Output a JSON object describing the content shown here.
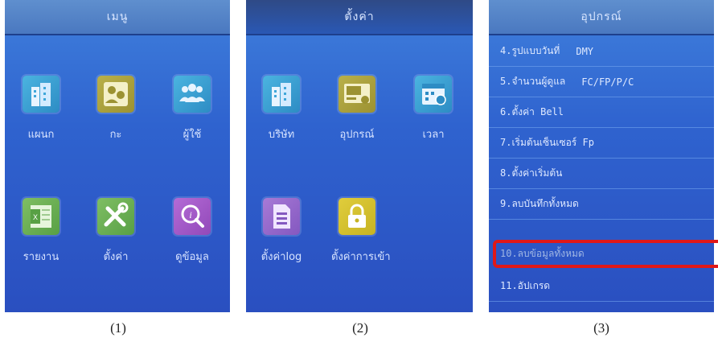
{
  "panel1": {
    "title": "เมนู",
    "tiles": [
      {
        "label": "แผนก",
        "icon": "buildings-icon",
        "color": "#3fa7da"
      },
      {
        "label": "กะ",
        "icon": "shift-users-icon",
        "color": "#b0a63f"
      },
      {
        "label": "ผู้ใช้",
        "icon": "users-icon",
        "color": "#3fa7da"
      },
      {
        "label": "รายงาน",
        "icon": "excel-report-icon",
        "color": "#6fb457"
      },
      {
        "label": "ตั้งค่า",
        "icon": "tools-icon",
        "color": "#6fb457"
      },
      {
        "label": "ดูข้อมูล",
        "icon": "search-info-icon",
        "color": "#a85ccc"
      }
    ]
  },
  "panel2": {
    "title": "ตั้งค่า",
    "tiles": [
      {
        "label": "บริษัท",
        "icon": "company-building-icon",
        "color": "#3fa7da"
      },
      {
        "label": "อุปกรณ์",
        "icon": "device-icon",
        "color": "#b0a63f"
      },
      {
        "label": "เวลา",
        "icon": "calendar-clock-icon",
        "color": "#3fa7da"
      },
      {
        "label": "ตั้งค่าlog",
        "icon": "log-document-icon",
        "color": "#9a6acb"
      },
      {
        "label": "ตั้งค่าการเข้า",
        "icon": "lock-icon",
        "color": "#d6c232"
      }
    ]
  },
  "panel3": {
    "title": "อุปกรณ์",
    "items": [
      {
        "label": "4.รูปแบบวันที่",
        "value": "DMY"
      },
      {
        "label": "5.จำนวนผู้ดูแล",
        "value": "FC/FP/P/C"
      },
      {
        "label": "6.ตั้งค่า Bell",
        "value": ""
      },
      {
        "label": "7.เริ่มต้นเซ็นเซอร์ Fp",
        "value": ""
      },
      {
        "label": "8.ตั้งค่าเริ่มต้น",
        "value": ""
      },
      {
        "label": "9.ลบบันทึกทั้งหมด",
        "value": ""
      },
      {
        "label": "10.ลบข้อมูลทั้งหมด",
        "value": ""
      },
      {
        "label": "11.อัปเกรด",
        "value": ""
      }
    ],
    "highlight_color": "#e01818"
  },
  "captions": [
    "(1)",
    "(2)",
    "(3)"
  ]
}
